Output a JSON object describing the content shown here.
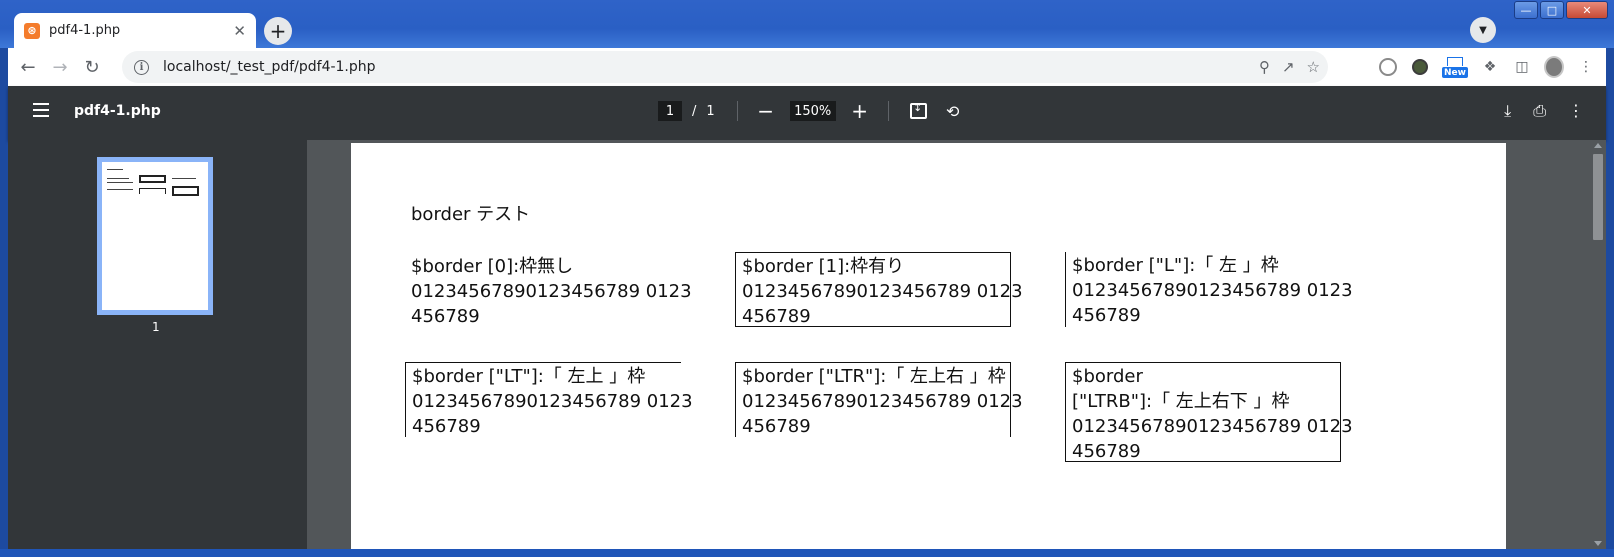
{
  "browser": {
    "tab_title": "pdf4-1.php",
    "new_tab_label": "+",
    "url": "localhost/_test_pdf/pdf4-1.php",
    "extension_new_badge": "New"
  },
  "pdf_toolbar": {
    "title": "pdf4-1.php",
    "current_page": "1",
    "page_separator": "/",
    "total_pages": "1",
    "zoom": "150%"
  },
  "thumbnail": {
    "page_number": "1"
  },
  "document": {
    "title": "border テスト",
    "cells": [
      {
        "lines": [
          "$border [0]:枠無し",
          "01234567890123456789 0123",
          "456789"
        ]
      },
      {
        "lines": [
          "$border [1]:枠有り",
          "01234567890123456789 0123",
          "456789"
        ]
      },
      {
        "lines": [
          "$border [\"L\"]:「 左 」枠",
          "01234567890123456789 0123",
          "456789"
        ]
      },
      {
        "lines": [
          "$border [\"LT\"]:「 左上 」枠",
          "01234567890123456789 0123",
          "456789"
        ]
      },
      {
        "lines": [
          "$border [\"LTR\"]:「 左上右 」枠",
          "01234567890123456789 0123",
          "456789"
        ]
      },
      {
        "lines": [
          "$border",
          "[\"LTRB\"]:「 左上右下 」枠",
          "01234567890123456789 0123",
          "456789"
        ]
      }
    ]
  },
  "colors": {
    "pdf_toolbar_bg": "#323639",
    "viewer_bg": "#525659",
    "thumbnail_highlight": "#8ab4f8"
  }
}
